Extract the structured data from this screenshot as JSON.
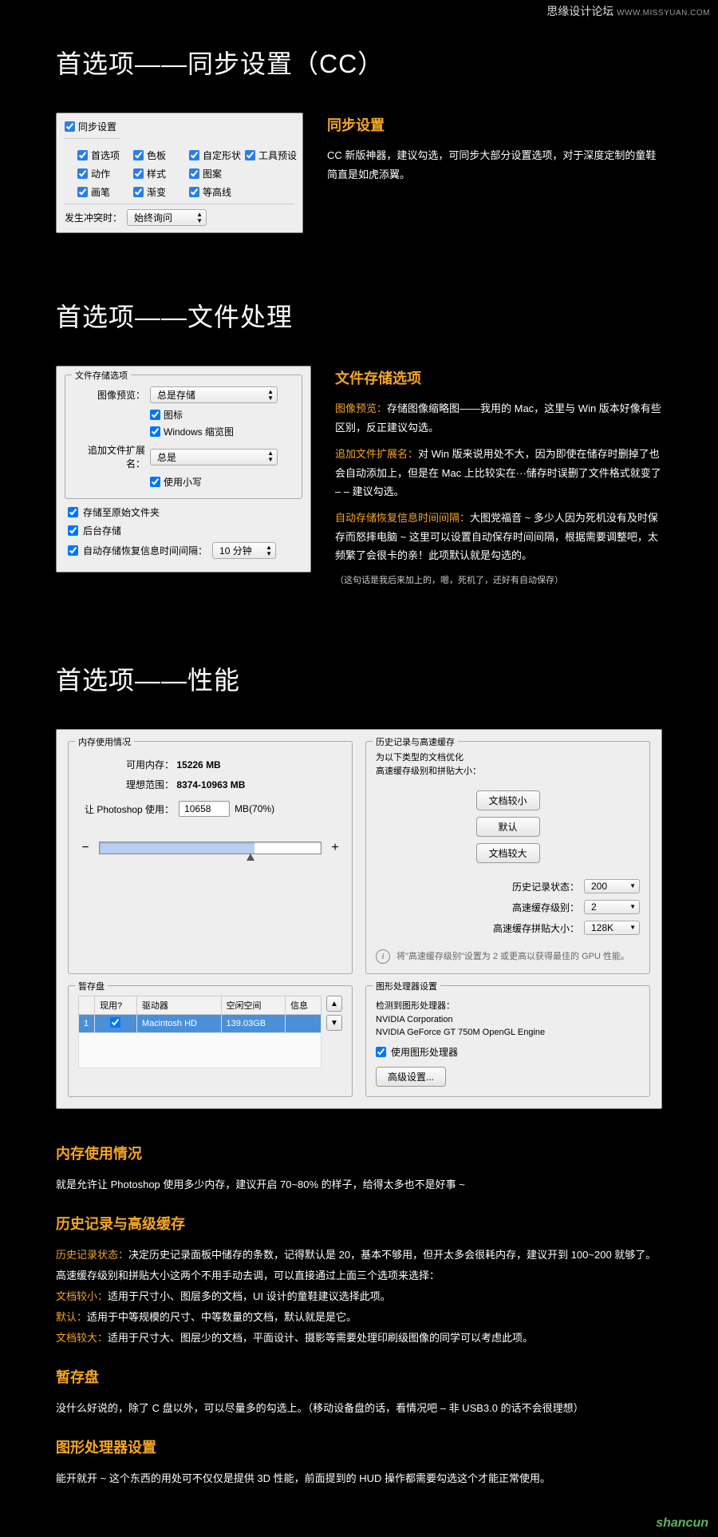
{
  "watermarks": {
    "top_brand": "思缘设计论坛",
    "top_url": "WWW.MISSYUAN.COM",
    "bottom": "shancun"
  },
  "section1": {
    "title": "首选项——同步设置（CC）",
    "panel": {
      "head": "同步设置",
      "items": [
        "首选项",
        "色板",
        "自定形状",
        "工具预设",
        "动作",
        "样式",
        "图案",
        "画笔",
        "渐变",
        "等高线"
      ],
      "conflict_label": "发生冲突时：",
      "conflict_value": "始终询问"
    },
    "desc": {
      "title": "同步设置",
      "body": "CC 新版神器，建议勾选，可同步大部分设置选项，对于深度定制的童鞋简直是如虎添翼。"
    }
  },
  "section2": {
    "title": "首选项——文件处理",
    "panel": {
      "fs_title": "文件存储选项",
      "preview_label": "图像预览：",
      "preview_value": "总是存储",
      "cb_icon": "图标",
      "cb_winthumb": "Windows 缩览图",
      "ext_label": "追加文件扩展名：",
      "ext_value": "总是",
      "cb_lowercase": "使用小写",
      "cb_savesource": "存储至原始文件夹",
      "cb_bgsave": "后台存储",
      "cb_autosave": "自动存储恢复信息时间间隔：",
      "autosave_value": "10 分钟"
    },
    "desc": {
      "title": "文件存储选项",
      "p1a": "图像预览：",
      "p1b": "存储图像缩略图——我用的 Mac，这里与 Win 版本好像有些区别，反正建议勾选。",
      "p2a": "追加文件扩展名：",
      "p2b": "对 Win 版来说用处不大，因为即使在储存时删掉了也会自动添加上，但是在 Mac 上比较实在···储存时误删了文件格式就变了 – – 建议勾选。",
      "p3a": "自动存储恢复信息时间间隔：",
      "p3b": "大图党福音 ~ 多少人因为死机没有及时保存而怒摔电脑 ~ 这里可以设置自动保存时间间隔，根据需要调整吧，太频繁了会很卡的亲！此项默认就是勾选的。",
      "note": "（这句话是我后来加上的，嗯，死机了，还好有自动保存）"
    }
  },
  "section3": {
    "title": "首选项——性能",
    "panel": {
      "mem": {
        "fs_title": "内存使用情况",
        "avail_label": "可用内存：",
        "avail_value": "15226 MB",
        "ideal_label": "理想范围：",
        "ideal_value": "8374-10963 MB",
        "use_label": "让 Photoshop 使用：",
        "use_value": "10658",
        "use_suffix": "MB(70%)",
        "slider_minus": "−",
        "slider_plus": "+"
      },
      "hist": {
        "fs_title": "历史记录与高速缓存",
        "optimize_line1": "为以下类型的文档优化",
        "optimize_line2": "高速缓存级别和拼贴大小：",
        "btn_small": "文档较小",
        "btn_default": "默认",
        "btn_big": "文档较大",
        "hist_states_label": "历史记录状态：",
        "hist_states_value": "200",
        "cache_level_label": "高速缓存级别：",
        "cache_level_value": "2",
        "tile_label": "高速缓存拼贴大小：",
        "tile_value": "128K",
        "info": "将\"高速缓存级别\"设置为 2 或更高以获得最佳的 GPU 性能。"
      },
      "scratch": {
        "fs_title": "暂存盘",
        "cols": [
          "现用?",
          "驱动器",
          "空闲空间",
          "信息"
        ],
        "row_num": "1",
        "row_drive": "Macintosh HD",
        "row_free": "139.03GB"
      },
      "gpu": {
        "fs_title": "图形处理器设置",
        "detected_label": "检测到图形处理器：",
        "vendor": "NVIDIA Corporation",
        "model": "NVIDIA GeForce GT 750M OpenGL Engine",
        "cb_use": "使用图形处理器",
        "btn_adv": "高级设置..."
      }
    }
  },
  "explain": {
    "h1": "内存使用情况",
    "p1": "就是允许让 Photoshop 使用多少内存，建议开启 70~80% 的样子，给得太多也不是好事 ~",
    "h2": "历史记录与高级缓存",
    "p2a": "历史记录状态：",
    "p2b": "决定历史记录面板中储存的条数，记得默认是 20，基本不够用，但开太多会很耗内存，建议开到 100~200 就够了。",
    "p3": "高速缓存级别和拼贴大小这两个不用手动去调，可以直接通过上面三个选项来选择：",
    "p4a": "文档较小：",
    "p4b": "适用于尺寸小、图层多的文档，UI 设计的童鞋建议选择此项。",
    "p5a": "默认：",
    "p5b": "适用于中等规模的尺寸、中等数量的文档，默认就是是它。",
    "p6a": "文档较大：",
    "p6b": "适用于尺寸大、图层少的文档，平面设计、摄影等需要处理印刷级图像的同学可以考虑此项。",
    "h3": "暂存盘",
    "p7": "没什么好说的，除了 C 盘以外，可以尽量多的勾选上。（移动设备盘的话，看情况吧 – 非 USB3.0 的话不会很理想）",
    "h4": "图形处理器设置",
    "p8": "能开就开 ~ 这个东西的用处可不仅仅是提供 3D 性能，前面提到的 HUD 操作都需要勾选这个才能正常使用。"
  }
}
